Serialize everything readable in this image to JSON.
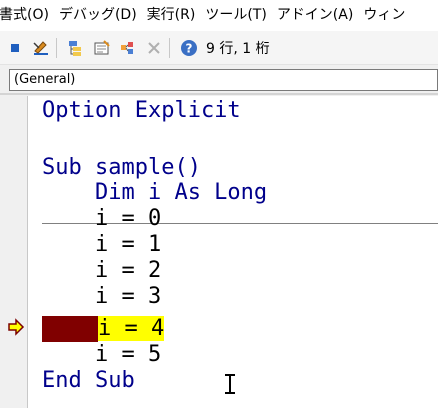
{
  "menu": [
    "書式(O)",
    "デバッグ(D)",
    "実行(R)",
    "ツール(T)",
    "アドイン(A)",
    "ウィン"
  ],
  "toolbar": {
    "status": "9 行, 1 桁"
  },
  "object_combo": {
    "value": "(General)"
  },
  "code": {
    "option_line": "Option Explicit",
    "sub_line": "Sub sample()",
    "dim_line": "    Dim i As Long",
    "assign_lines": [
      "    i = 0",
      "    i = 1",
      "    i = 2",
      "    i = 3"
    ],
    "current_line": "i = 4",
    "after_lines": [
      "    i = 5"
    ],
    "end_line": "End Sub"
  },
  "colors": {
    "keyword": "#00008b",
    "execution_highlight": "#ffff00",
    "breakpoint": "#800000"
  }
}
